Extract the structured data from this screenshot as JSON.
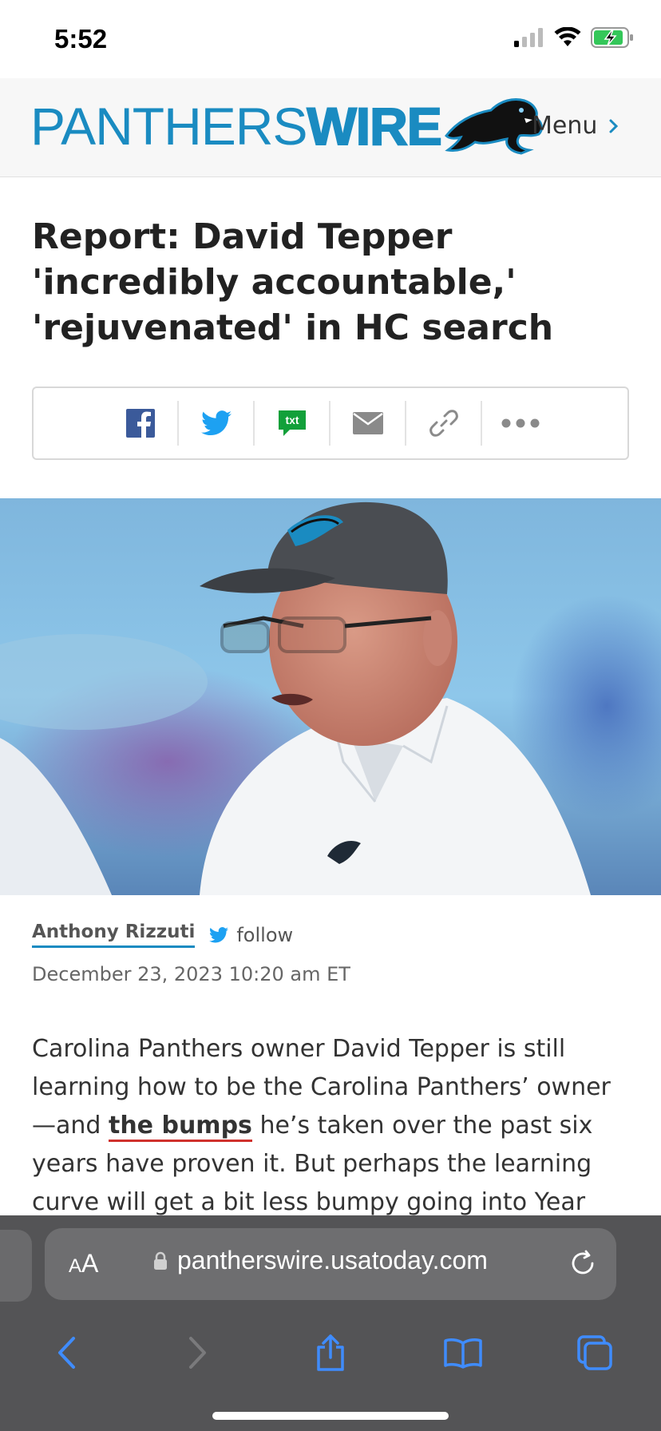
{
  "status": {
    "time": "5:52"
  },
  "header": {
    "logo_light": "PANTHERS",
    "logo_bold": "WIRE",
    "menu_label": "Menu"
  },
  "article": {
    "headline": "Report: David Tepper 'incredibly accountable,' 'rejuvenated' in HC search",
    "author": "Anthony Rizzuti",
    "follow_label": "follow",
    "date": "December 23, 2023 10:20 am ET",
    "body_before": "Carolina Panthers owner David Tepper is still learning how to be the Carolina Panthers’ owner —and ",
    "body_link": "the bumps",
    "body_after": " he’s taken over the past six years have proven it. But perhaps the learning curve will get a bit less bumpy going into Year"
  },
  "share": {
    "icons": [
      "facebook-icon",
      "twitter-icon",
      "txt-icon",
      "email-icon",
      "link-icon",
      "more-icon"
    ],
    "txt_label": "txt"
  },
  "browser": {
    "aa_small": "A",
    "aa_big": "A",
    "url": "pantherswire.usatoday.com"
  },
  "colors": {
    "brand_blue": "#1a8bc1",
    "link_underline": "#d0312d",
    "ios_blue": "#3f8cff"
  }
}
